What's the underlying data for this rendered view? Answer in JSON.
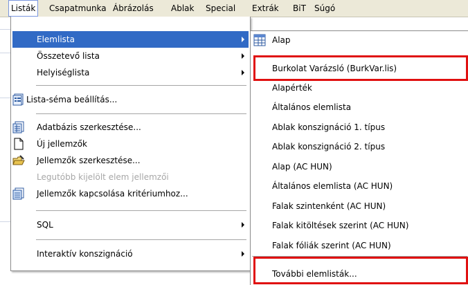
{
  "menubar": {
    "items": [
      {
        "label": "Listák"
      },
      {
        "label": "Csapatmunka"
      },
      {
        "label": "Ábrázolás"
      },
      {
        "label": "Ablak"
      },
      {
        "label": "Special"
      },
      {
        "label": "Extrák"
      },
      {
        "label": "BiT"
      },
      {
        "label": "Súgó"
      }
    ]
  },
  "left_menu": {
    "items": [
      {
        "label": "Elemlista",
        "submenu": true,
        "selected": true
      },
      {
        "label": "Összetevő lista",
        "submenu": true
      },
      {
        "label": "Helyiséglista",
        "submenu": true
      },
      {
        "label": "Lista-séma beállítás...",
        "icon": "list-scheme-icon"
      },
      {
        "label": "Adatbázis szerkesztése...",
        "icon": "database-edit-icon"
      },
      {
        "label": "Új jellemzők",
        "icon": "new-document-icon"
      },
      {
        "label": "Jellemzők szerkesztése...",
        "icon": "folder-edit-icon"
      },
      {
        "label": "Legutóbb kijelölt elem jellemzői",
        "disabled": true
      },
      {
        "label": "Jellemzők kapcsolása kritériumhoz...",
        "icon": "link-criteria-icon"
      },
      {
        "label": "SQL",
        "submenu": true
      },
      {
        "label": "Interaktív konszignáció",
        "submenu": true
      }
    ]
  },
  "right_menu": {
    "items": [
      {
        "label": "Alap",
        "icon": "table-icon"
      },
      {
        "label": "Burkolat Varázsló (BurkVar.lis)"
      },
      {
        "label": "Alapérték"
      },
      {
        "label": "Általános elemlista"
      },
      {
        "label": "Ablak konszignáció 1. típus"
      },
      {
        "label": "Ablak konszignáció 2. típus"
      },
      {
        "label": "Alap (AC HUN)"
      },
      {
        "label": "Általános elemlista (AC HUN)"
      },
      {
        "label": "Falak szintenként (AC HUN)"
      },
      {
        "label": "Falak kitöltések szerint (AC HUN)"
      },
      {
        "label": "Falak fóliák szerint (AC HUN)"
      },
      {
        "label": "További elemlisták..."
      }
    ]
  },
  "colors": {
    "selection": "#316ac5",
    "highlight_border": "#e01010",
    "menubar_bg": "#ece9d8"
  }
}
